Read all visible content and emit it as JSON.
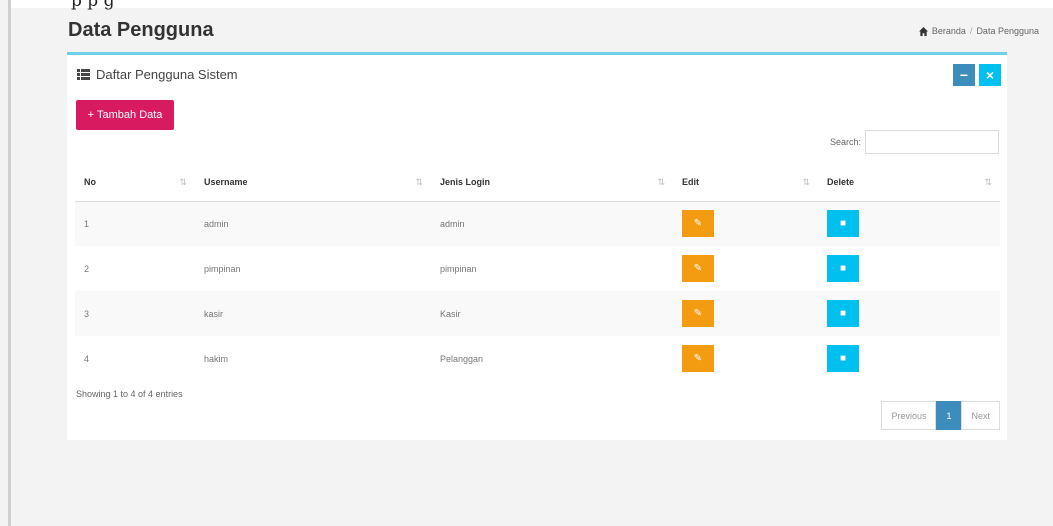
{
  "top_text": "p                  p  g",
  "page_title": "Data Pengguna",
  "breadcrumb": {
    "home": "Beranda",
    "current": "Data Pengguna"
  },
  "box": {
    "title": "Daftar Pengguna Sistem",
    "tools": {
      "minimize": "−",
      "close": "×"
    }
  },
  "add_button": {
    "icon": "+",
    "label": "Tambah Data"
  },
  "search": {
    "label": "Search:",
    "value": ""
  },
  "table": {
    "columns": [
      "No",
      "Username",
      "Jenis Login",
      "Edit",
      "Delete"
    ],
    "rows": [
      {
        "no": "1",
        "username": "admin",
        "jenis_login": "admin"
      },
      {
        "no": "2",
        "username": "pimpinan",
        "jenis_login": "pimpinan"
      },
      {
        "no": "3",
        "username": "kasir",
        "jenis_login": "Kasir"
      },
      {
        "no": "4",
        "username": "hakim",
        "jenis_login": "Pelanggan"
      }
    ]
  },
  "info": "Showing 1 to 4 of 4 entries",
  "pagination": {
    "previous": "Previous",
    "page": "1",
    "next": "Next"
  },
  "colors": {
    "accent": "#3c8dbc",
    "add": "#d81b60",
    "edit": "#f39c12",
    "delete": "#00c0ef",
    "box_border": "#6fd2e8"
  }
}
